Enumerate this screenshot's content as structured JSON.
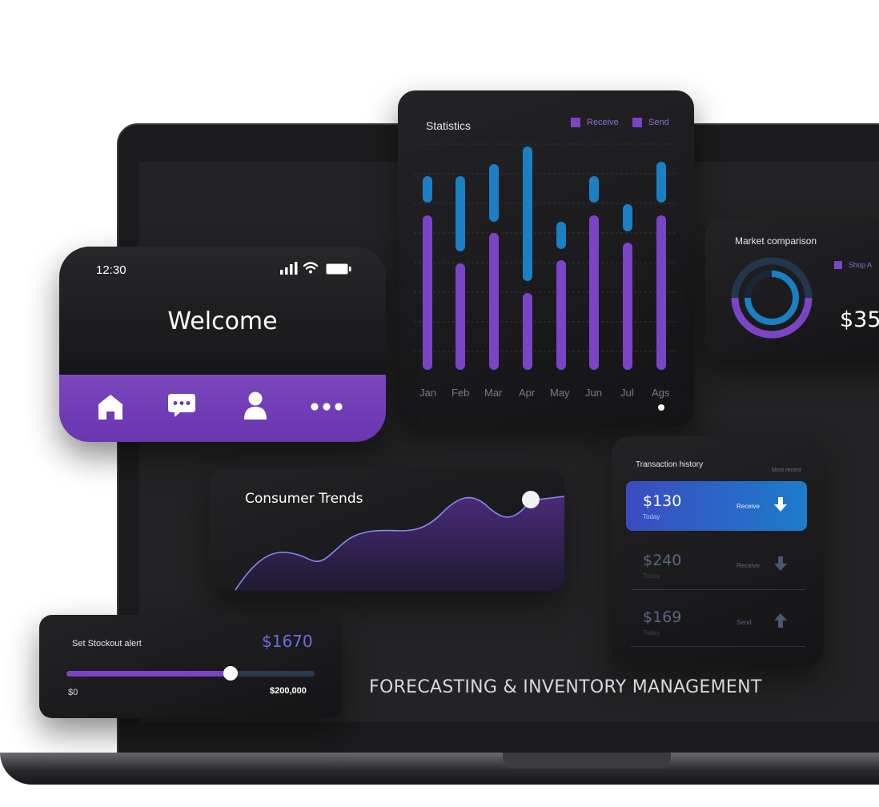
{
  "statistics": {
    "title": "Statistics",
    "legend": [
      {
        "label": "Receive",
        "color": "#7b44c6"
      },
      {
        "label": "Send",
        "color": "#7b44c6"
      }
    ],
    "months": [
      "Jan",
      "Feb",
      "Mar",
      "Apr",
      "May",
      "Jun",
      "Jul",
      "Ags"
    ]
  },
  "phone": {
    "time": "12:30",
    "welcome": "Welcome",
    "status_icons": [
      "signal-icon",
      "wifi-icon",
      "battery-icon"
    ],
    "nav_icons": [
      "home-icon",
      "chat-icon",
      "user-icon",
      "more-icon"
    ]
  },
  "market": {
    "title": "Market comparison",
    "legend": "Shop A",
    "amount": "$35"
  },
  "consumer_trends": {
    "title": "Consumer Trends"
  },
  "transactions": {
    "title": "Transaction history",
    "filter": "Most recent",
    "items": [
      {
        "amount": "$130",
        "day": "Today",
        "type": "Receive",
        "icon": "arrow-down-icon"
      },
      {
        "amount": "$240",
        "day": "Today",
        "type": "Receive",
        "icon": "arrow-down-icon"
      },
      {
        "amount": "$169",
        "day": "Today",
        "type": "Send",
        "icon": "arrow-up-icon"
      }
    ]
  },
  "stockout": {
    "title": "Set Stockout alert",
    "amount": "$1670",
    "min": "$0",
    "max": "$200,000",
    "level_fraction": 0.66
  },
  "headline": "FORECASTING & INVENTORY MANAGEMENT",
  "colors": {
    "purple": "#7b44c6",
    "blue": "#1b7fc4",
    "accent_text": "#6e6ee0"
  }
}
